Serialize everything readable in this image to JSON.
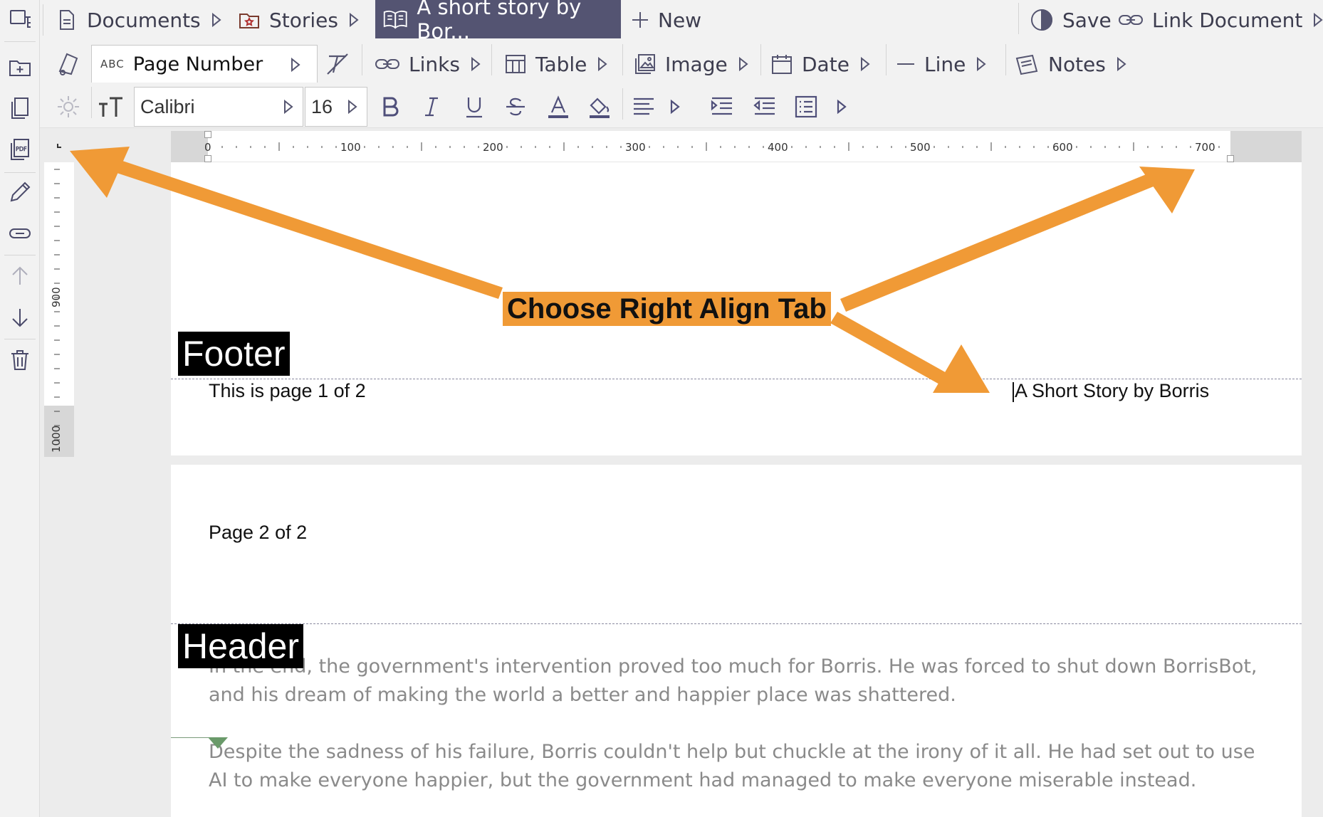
{
  "toolbar": {
    "tabs": [
      {
        "label": "Documents",
        "icon": "document-icon"
      },
      {
        "label": "Stories",
        "icon": "stories-folder-icon"
      },
      {
        "label": "A short story by Bor...",
        "icon": "book-open-icon"
      }
    ],
    "new_label": "New",
    "save_label": "Save",
    "link_document_label": "Link Document"
  },
  "insert_bar": {
    "field_prefix": "ABC",
    "field_value": "Page Number",
    "links_label": "Links",
    "table_label": "Table",
    "image_label": "Image",
    "date_label": "Date",
    "line_label": "Line",
    "notes_label": "Notes"
  },
  "format_bar": {
    "font_family": "Calibri",
    "font_size": "16"
  },
  "ruler": {
    "labels": [
      "0",
      "100",
      "200",
      "300",
      "400",
      "500",
      "600",
      "700"
    ],
    "vertical_labels": [
      "900",
      "1000"
    ]
  },
  "document": {
    "footer_tag": "Footer",
    "footer_left": "This is page 1 of 2",
    "footer_right": "A Short Story by Borris",
    "page2_top": "Page 2 of 2",
    "header_tag": "Header",
    "para1": "In the end, the government's intervention proved too much for Borris. He was forced to shut down BorrisBot, and his dream of making the world a better and happier place was shattered.",
    "para2": "Despite the sadness of his failure, Borris couldn't help but chuckle at the irony of it all. He had set out to use AI to make everyone happier, but the government had managed to make everyone miserable instead."
  },
  "annotation": {
    "callout": "Choose Right Align Tab",
    "color": "#f09a36"
  },
  "colors": {
    "active_tab": "#545472",
    "accent": "#4f4f7a"
  }
}
